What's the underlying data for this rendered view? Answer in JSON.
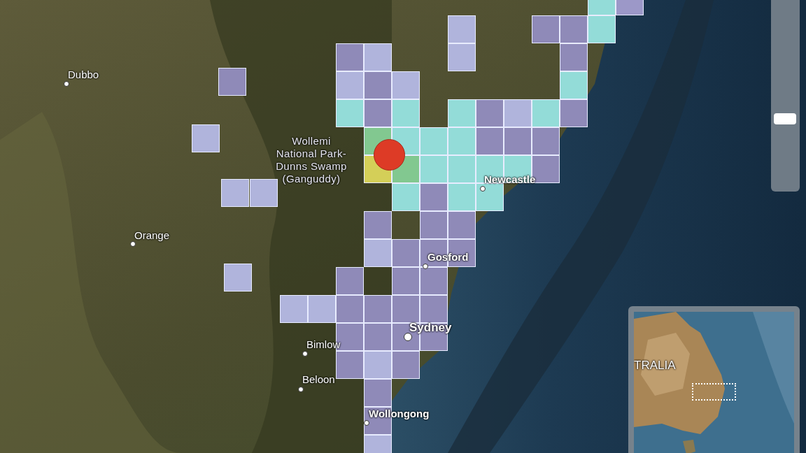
{
  "places": [
    {
      "name": "Dubbo",
      "kind": "town"
    },
    {
      "name": "Wollemi National Park-Dunns Swamp (Ganguddy)",
      "kind": "park"
    },
    {
      "name": "Orange",
      "kind": "town"
    },
    {
      "name": "Newcastle",
      "kind": "city"
    },
    {
      "name": "Gosford",
      "kind": "city"
    },
    {
      "name": "Sydney",
      "kind": "capital"
    },
    {
      "name": "Bimlow",
      "kind": "town"
    },
    {
      "name": "Beloon",
      "kind": "town"
    },
    {
      "name": "Wollongong",
      "kind": "city"
    }
  ],
  "grid": {
    "rows": [
      [
        null,
        null,
        null,
        null,
        null,
        null,
        null,
        null,
        null,
        null,
        null,
        {
          "color": "#93dcd8"
        },
        {
          "color": "#9c98c8"
        }
      ],
      [
        null,
        null,
        null,
        null,
        null,
        null,
        {
          "color": "#b0b4dc"
        },
        null,
        null,
        {
          "color": "#8f8ab8"
        },
        {
          "color": "#8f8ab8"
        },
        {
          "color": "#93dcd8"
        },
        null
      ],
      [
        null,
        null,
        {
          "color": "#8f8ab8"
        },
        {
          "color": "#b0b4dc"
        },
        null,
        null,
        {
          "color": "#b0b4dc"
        },
        null,
        null,
        null,
        {
          "color": "#8f8ab8"
        },
        null,
        null
      ],
      [
        null,
        null,
        {
          "color": "#b0b4dc"
        },
        {
          "color": "#8f8ab8"
        },
        {
          "color": "#b0b4dc"
        },
        null,
        null,
        null,
        null,
        null,
        {
          "color": "#93dcd8"
        },
        null,
        null
      ],
      [
        null,
        null,
        {
          "color": "#93dcd8"
        },
        {
          "color": "#8f8ab8"
        },
        {
          "color": "#93dcd8"
        },
        null,
        {
          "color": "#93dcd8"
        },
        {
          "color": "#8f8ab8"
        },
        {
          "color": "#b0b4dc"
        },
        {
          "color": "#93dcd8"
        },
        {
          "color": "#8f8ab8"
        },
        null,
        null
      ],
      [
        null,
        null,
        null,
        {
          "color": "#82c890"
        },
        {
          "color": "#93dcd8"
        },
        {
          "color": "#93dcd8"
        },
        {
          "color": "#93dcd8"
        },
        {
          "color": "#8f8ab8"
        },
        {
          "color": "#8f8ab8"
        },
        {
          "color": "#8f8ab8"
        },
        null,
        null,
        null
      ],
      [
        null,
        null,
        null,
        {
          "color": "#d4cf58"
        },
        {
          "color": "#82c890"
        },
        {
          "color": "#93dcd8"
        },
        {
          "color": "#93dcd8"
        },
        {
          "color": "#93dcd8"
        },
        {
          "color": "#93dcd8"
        },
        {
          "color": "#8f8ab8"
        },
        null,
        null,
        null
      ],
      [
        null,
        null,
        null,
        null,
        {
          "color": "#93dcd8"
        },
        {
          "color": "#8f8ab8"
        },
        {
          "color": "#93dcd8"
        },
        {
          "color": "#93dcd8"
        },
        null,
        null,
        null,
        null,
        null
      ],
      [
        null,
        null,
        null,
        {
          "color": "#8f8ab8"
        },
        null,
        {
          "color": "#8f8ab8"
        },
        {
          "color": "#8f8ab8"
        },
        null,
        null,
        null,
        null,
        null,
        null
      ],
      [
        null,
        null,
        null,
        {
          "color": "#b0b4dc"
        },
        {
          "color": "#8f8ab8"
        },
        {
          "color": "#8f8ab8"
        },
        {
          "color": "#8f8ab8"
        },
        null,
        null,
        null,
        null,
        null,
        null
      ],
      [
        null,
        null,
        {
          "color": "#8f8ab8"
        },
        null,
        {
          "color": "#8f8ab8"
        },
        {
          "color": "#8f8ab8"
        },
        null,
        null,
        null,
        null,
        null,
        null,
        null
      ],
      [
        {
          "color": "#b0b4dc"
        },
        {
          "color": "#b0b4dc"
        },
        {
          "color": "#8f8ab8"
        },
        {
          "color": "#8f8ab8"
        },
        {
          "color": "#8f8ab8"
        },
        {
          "color": "#8f8ab8"
        },
        null,
        null,
        null,
        null,
        null,
        null,
        null
      ],
      [
        null,
        null,
        {
          "color": "#8f8ab8"
        },
        {
          "color": "#8f8ab8"
        },
        {
          "color": "#8f8ab8"
        },
        {
          "color": "#8f8ab8"
        },
        null,
        null,
        null,
        null,
        null,
        null,
        null
      ],
      [
        null,
        null,
        {
          "color": "#8f8ab8"
        },
        {
          "color": "#b0b4dc"
        },
        {
          "color": "#8f8ab8"
        },
        null,
        null,
        null,
        null,
        null,
        null,
        null,
        null
      ],
      [
        null,
        null,
        null,
        {
          "color": "#8f8ab8"
        },
        null,
        null,
        null,
        null,
        null,
        null,
        null,
        null,
        null
      ],
      [
        null,
        null,
        null,
        {
          "color": "#8f8ab8"
        },
        null,
        null,
        null,
        null,
        null,
        null,
        null,
        null,
        null
      ],
      [
        null,
        null,
        null,
        {
          "color": "#b0b4dc"
        },
        null,
        null,
        null,
        null,
        null,
        null,
        null,
        null,
        null
      ]
    ]
  },
  "isolated_cells": [
    {
      "color": "#8f8ab8"
    },
    {
      "color": "#b0b4dc"
    },
    {
      "color": "#b0b4dc"
    },
    {
      "color": "#b0b4dc"
    },
    {
      "color": "#b0b4dc"
    }
  ],
  "zoom_slider": {
    "level": 0.36
  },
  "inset_map": {
    "label": "TRALIA"
  }
}
